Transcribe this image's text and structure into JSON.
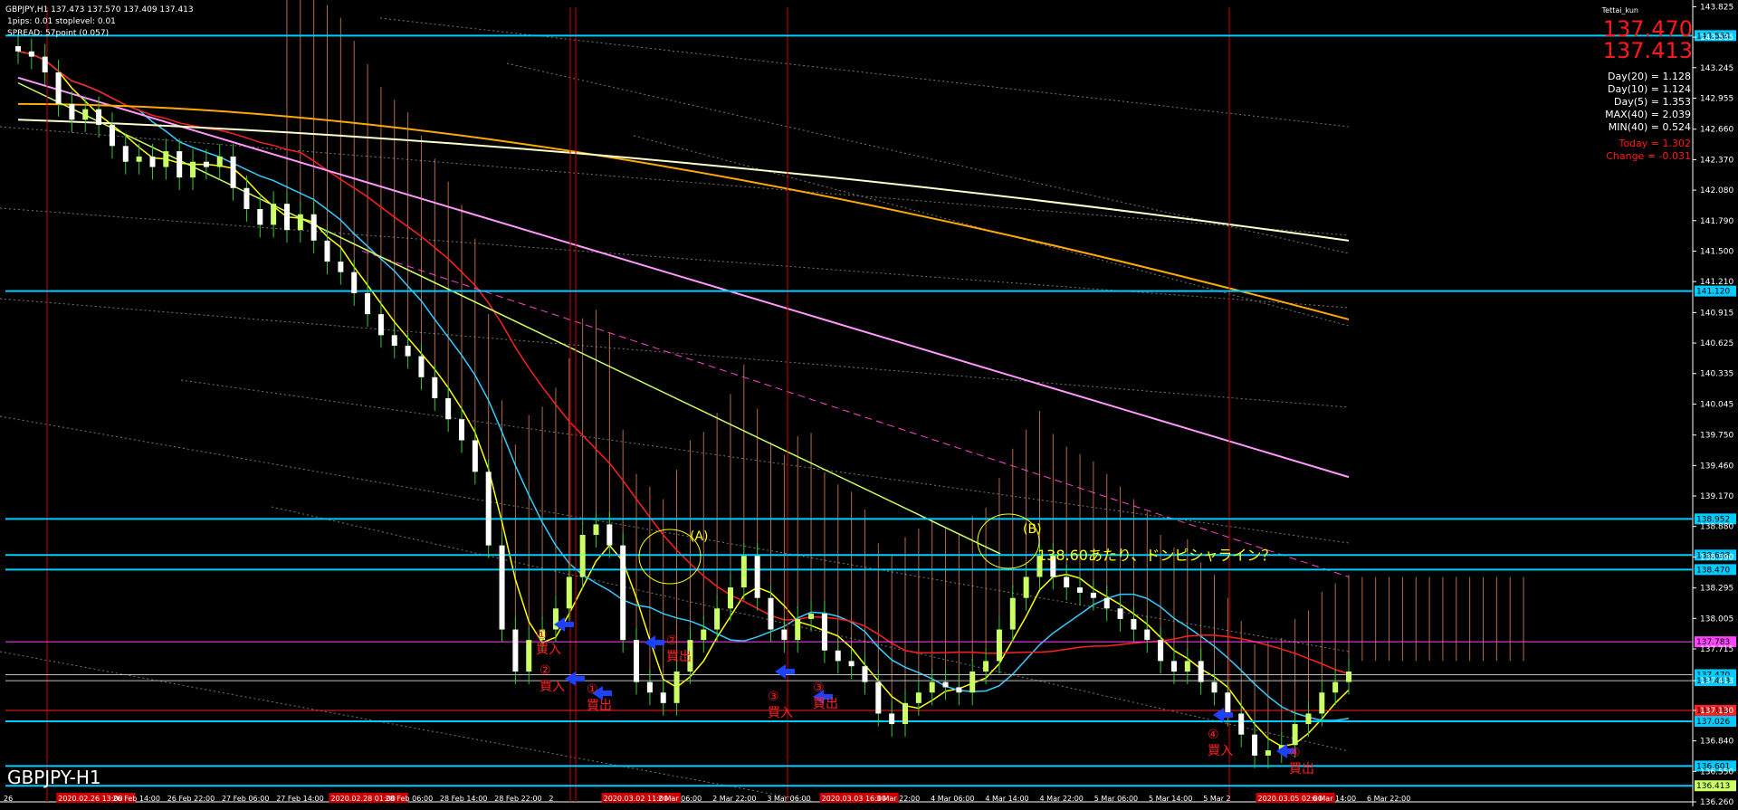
{
  "header": {
    "symbol_line": "GBPJPY,H1  137.473 137.570 137.409 137.413",
    "info_line": "1pips: 0.01  stoplevel: 0.01",
    "spread_line": "SPREAD: 57point (0.057)",
    "author": "Tettai_kun"
  },
  "watermark": "GBPJPY-H1",
  "price_panel": {
    "bid": "137.470",
    "ask": "137.413",
    "stats": [
      "Day(20) = 1.128",
      "Day(10) = 1.124",
      "Day(5) = 1.353",
      "MAX(40) = 2.039",
      "MIN(40) = 0.524"
    ],
    "today": "Today = 1.302",
    "change": "Change = -0.031"
  },
  "annotations": {
    "label_a": "(A)",
    "label_b": "(B)",
    "note": "138.60あたり、ドンピシャライン？",
    "signals": [
      {
        "num": "①",
        "act": "買入"
      },
      {
        "num": "②",
        "act": "買入"
      },
      {
        "num": "①",
        "act": "買出"
      },
      {
        "num": "②",
        "act": "買出"
      },
      {
        "num": "③",
        "act": "買入"
      },
      {
        "num": "③",
        "act": "買出"
      },
      {
        "num": "④",
        "act": "買入"
      },
      {
        "num": "④",
        "act": "買出"
      }
    ]
  },
  "colors": {
    "background": "#000000",
    "bull_candle": "#ccff66",
    "bear_candle": "#ffffff",
    "wick": "#33cc33",
    "level_line": "#00ccff",
    "vline": "#cc0000",
    "ma_yellow": "#ffff00",
    "ma_cyan": "#33ccff",
    "ma_red": "#ff2020",
    "ma_pink": "#ff99ff",
    "ma_orange": "#ffaa00",
    "ma_white": "#ffffcc",
    "cloud": "#ff9966",
    "signal_text": "#ff2020",
    "arrow": "#1e40ff"
  },
  "chart_data": {
    "type": "candlestick",
    "symbol": "GBPJPY",
    "timeframe": "H1",
    "ylim": [
      136.26,
      143.82
    ],
    "y_ticks": [
      "143.825",
      "143.535",
      "143.245",
      "142.955",
      "142.660",
      "142.370",
      "142.080",
      "141.790",
      "141.500",
      "141.210",
      "140.915",
      "140.625",
      "140.335",
      "140.045",
      "139.750",
      "139.460",
      "139.170",
      "138.880",
      "138.590",
      "138.295",
      "138.005",
      "137.715",
      "137.413",
      "137.130",
      "136.840",
      "136.550",
      "136.260"
    ],
    "x_labels": [
      "26",
      "2020.02.26 13:00",
      "26 Feb 14:00",
      "26 Feb 22:00",
      "27 Feb 06:00",
      "27 Feb 14:00",
      "2020.02.28 01:00",
      "28 Feb 06:00",
      "28 Feb 14:00",
      "28 Feb 22:00",
      "2",
      "2020.03.02 11:00",
      "2 Mar 06:00",
      "2 Mar 22:00",
      "3 Mar 06:00",
      "2020.03.03 16:00",
      "3 Mar 22:00",
      "4 Mar 06:00",
      "4 Mar 14:00",
      "4 Mar 22:00",
      "5 Mar 06:00",
      "5 Mar 14:00",
      "5 Mar 2",
      "2020.03.05 02:00",
      "6 Mar 14:00",
      "6 Mar 22:00"
    ],
    "level_labels": [
      {
        "price": 143.55,
        "text": "143.550"
      },
      {
        "price": 141.12,
        "text": "141.120"
      },
      {
        "price": 138.952,
        "text": "138.952"
      },
      {
        "price": 138.608,
        "text": "138.608"
      },
      {
        "price": 138.47,
        "text": "138.470"
      },
      {
        "price": 137.783,
        "text": "137.783"
      },
      {
        "price": 137.47,
        "text": "137.470"
      },
      {
        "price": 137.413,
        "text": "137.413"
      },
      {
        "price": 137.13,
        "text": "137.130"
      },
      {
        "price": 137.026,
        "text": "137.026"
      },
      {
        "price": 136.601,
        "text": "136.601"
      },
      {
        "price": 136.413,
        "text": "136.413"
      }
    ],
    "close": [
      143.4,
      143.35,
      143.2,
      142.9,
      142.75,
      142.85,
      142.7,
      142.5,
      142.35,
      142.4,
      142.3,
      142.45,
      142.2,
      142.35,
      142.3,
      142.4,
      142.1,
      141.9,
      141.75,
      141.95,
      141.7,
      141.85,
      141.6,
      141.4,
      141.3,
      141.1,
      140.9,
      140.7,
      140.6,
      140.5,
      140.3,
      140.1,
      139.9,
      139.7,
      139.4,
      138.7,
      137.9,
      137.5,
      137.8,
      137.9,
      138.1,
      138.4,
      138.8,
      138.9,
      138.7,
      137.8,
      137.4,
      137.3,
      137.2,
      137.5,
      137.8,
      137.9,
      138.1,
      138.3,
      138.6,
      138.2,
      137.9,
      137.8,
      138.0,
      138.05,
      137.7,
      137.6,
      137.55,
      137.4,
      137.1,
      137.0,
      137.2,
      137.3,
      137.4,
      137.35,
      137.3,
      137.5,
      137.6,
      137.9,
      138.2,
      138.4,
      138.6,
      138.4,
      138.3,
      138.25,
      138.2,
      138.1,
      138.0,
      137.9,
      137.8,
      137.6,
      137.5,
      137.6,
      137.4,
      137.3,
      137.1,
      136.9,
      136.7,
      136.75,
      136.8,
      137.0,
      137.1,
      137.3,
      137.4,
      137.5
    ],
    "moving_averages": [
      "yellow",
      "cyan",
      "red",
      "pink",
      "orange",
      "white"
    ]
  }
}
